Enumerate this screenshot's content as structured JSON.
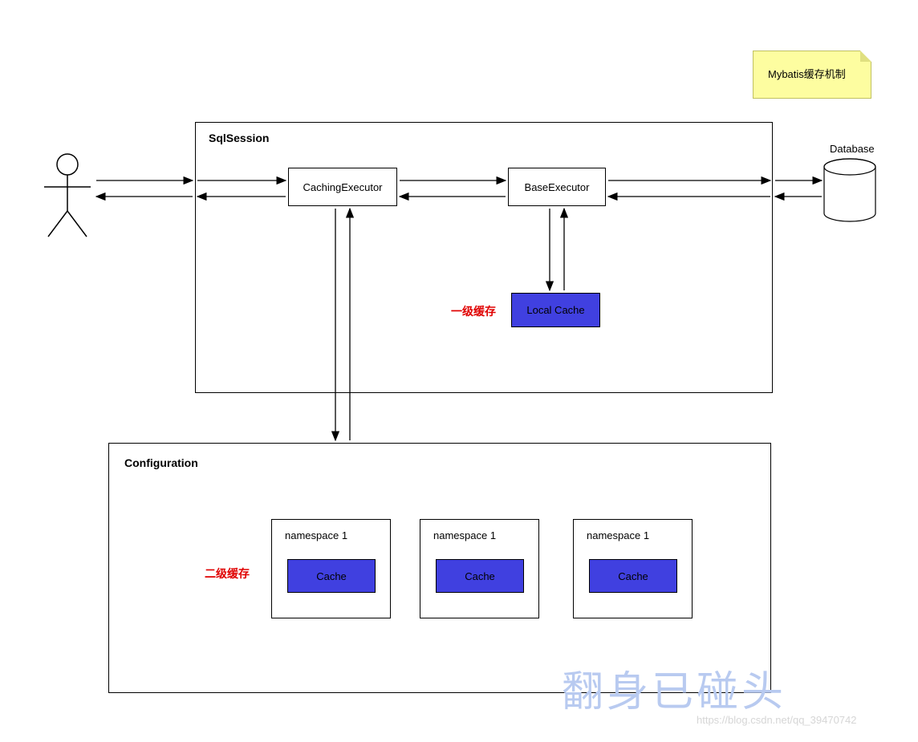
{
  "note": {
    "text": "Mybatis缓存机制"
  },
  "database": {
    "label": "Database"
  },
  "sqlsession": {
    "title": "SqlSession",
    "caching_executor": "CachingExecutor",
    "base_executor": "BaseExecutor",
    "local_cache": "Local Cache",
    "level1_label": "一级缓存"
  },
  "configuration": {
    "title": "Configuration",
    "level2_label": "二级缓存",
    "namespaces": [
      {
        "title": "namespace 1",
        "cache": "Cache"
      },
      {
        "title": "namespace 1",
        "cache": "Cache"
      },
      {
        "title": "namespace 1",
        "cache": "Cache"
      }
    ]
  },
  "watermark": {
    "big": "翻身已碰头",
    "small": "https://blog.csdn.net/qq_39470742"
  }
}
